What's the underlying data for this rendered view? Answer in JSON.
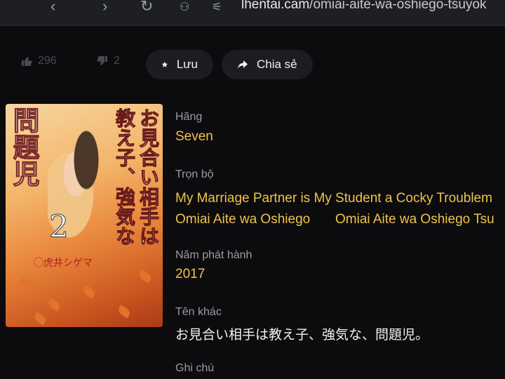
{
  "browser": {
    "url_host": "lhentai.cam",
    "url_path": "/omiai-aite-wa-oshiego-tsuyok"
  },
  "actions": {
    "likes": "296",
    "dislikes": "2",
    "save_label": "Lưu",
    "share_label": "Chia sẻ"
  },
  "cover": {
    "title_vertical": "問題児",
    "subtitle_vertical": "お見合い相手は教え子、強気な",
    "volume": "2",
    "author": "◯虎井シゲマ"
  },
  "info": {
    "brand_label": "Hãng",
    "brand_value": "Seven",
    "series_label": "Trọn bộ",
    "series_1": "My Marriage Partner is My Student a Cocky Troublem",
    "series_2": "Omiai Aite wa Oshiego",
    "series_3": "Omiai Aite wa Oshiego Tsu",
    "year_label": "Năm phát hành",
    "year_value": "2017",
    "other_label": "Tên khác",
    "other_value": "お見合い相手は教え子、強気な、問題児。",
    "note_label": "Ghi chú"
  },
  "colors": {
    "accent": "#f0c34a",
    "background": "#0c0c0e",
    "pill": "#1c1d21"
  }
}
